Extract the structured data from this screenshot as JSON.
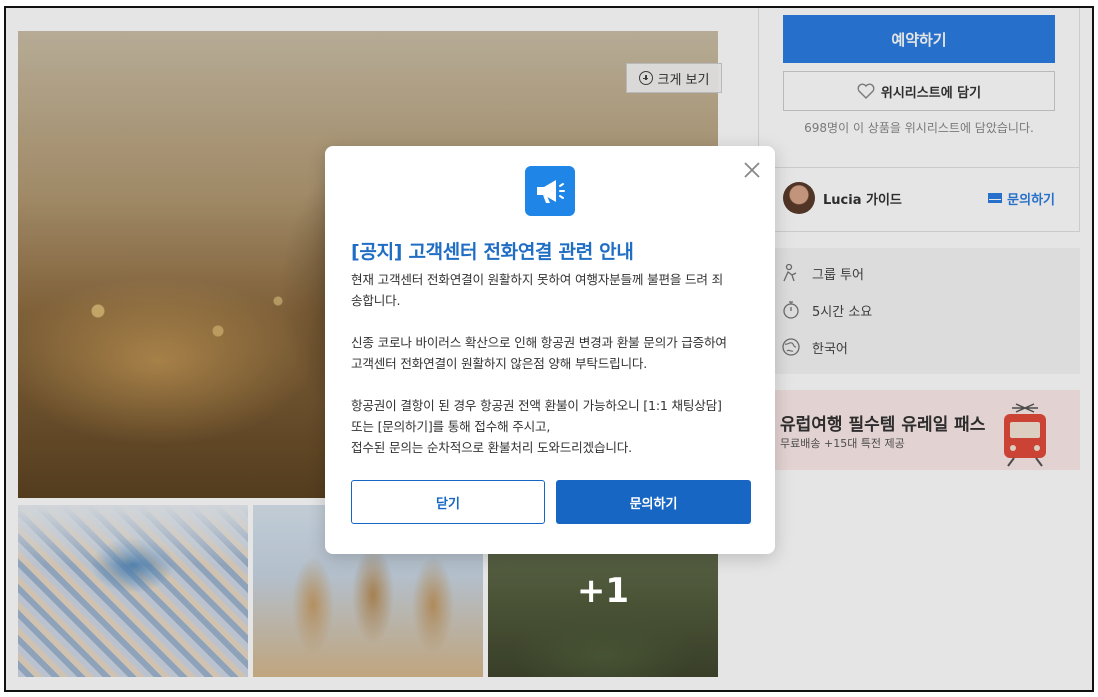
{
  "gallery": {
    "enlarge_label": "크게 보기",
    "more_count": "+1"
  },
  "booking": {
    "reserve_label": "예약하기",
    "wishlist_label": "위시리스트에 담기",
    "wishlist_count_text": "698명이 이 상품을 위시리스트에 담았습니다.",
    "guide_name": "Lucia 가이드",
    "inquiry_label": "문의하기"
  },
  "info": {
    "items": [
      {
        "icon": "group-icon",
        "label": "그룹 투어"
      },
      {
        "icon": "stopwatch-icon",
        "label": "5시간 소요"
      },
      {
        "icon": "globe-icon",
        "label": "한국어"
      }
    ]
  },
  "banner": {
    "title": "유럽여행 필수템 유레일 패스",
    "subtitle": "무료배송 +15대 특전 제공"
  },
  "modal": {
    "title": "[공지] 고객센터 전화연결 관련 안내",
    "paragraphs": [
      [
        "현재 고객센터 전화연결이 원활하지 못하여 여행자분들께 불편을 드려 죄",
        "송합니다."
      ],
      [
        "신종 코로나 바이러스 확산으로 인해 항공권 변경과 환불 문의가 급증하여",
        "고객센터 전화연결이 원활하지 않은점 양해 부탁드립니다."
      ],
      [
        "항공권이 결항이 된 경우 항공권 전액 환불이 가능하오니 [1:1 채팅상담]",
        "또는 [문의하기]를 통해 접수해 주시고,",
        "접수된 문의는 순차적으로 환불처리 도와드리겠습니다."
      ]
    ],
    "close_label": "닫기",
    "inquiry_label": "문의하기"
  },
  "colors": {
    "primary": "#1766c4",
    "title_blue": "#1f6ec4",
    "icon_blue": "#1f86e8",
    "reserve_blue": "#2b7de2"
  }
}
